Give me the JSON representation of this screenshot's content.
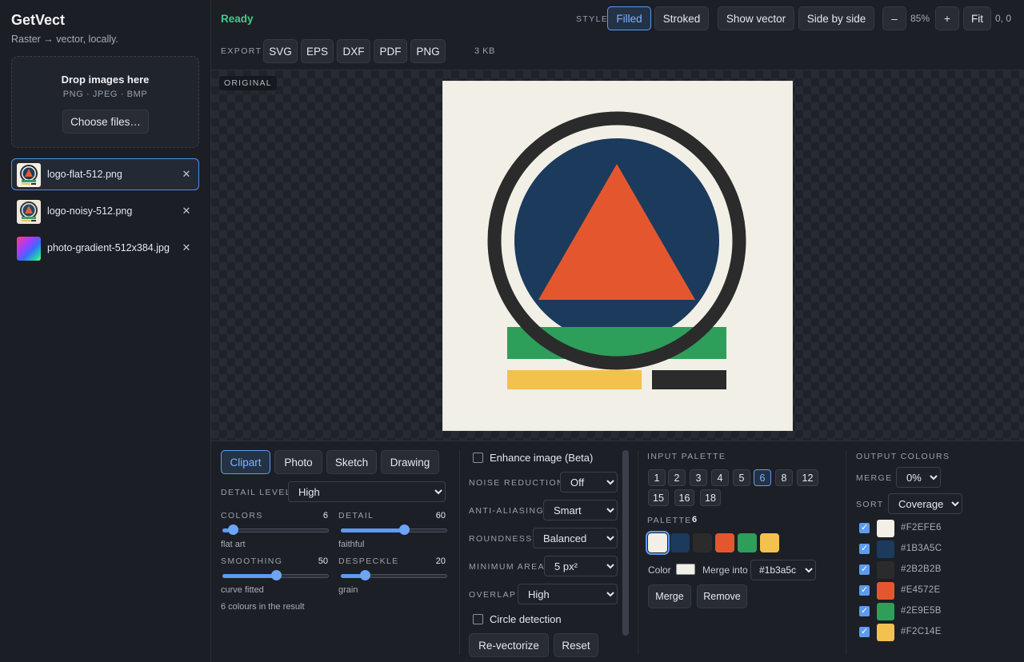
{
  "app": {
    "title": "GetVect",
    "tagline": "Raster → vector, locally."
  },
  "dropzone": {
    "title": "Drop images here",
    "formats": "PNG · JPEG · BMP",
    "choose_label": "Choose files…"
  },
  "files": [
    {
      "name": "logo-flat-512.png",
      "selected": true
    },
    {
      "name": "logo-noisy-512.png",
      "selected": false
    },
    {
      "name": "photo-gradient-512x384.jpg",
      "selected": false
    }
  ],
  "toolbar": {
    "status": "Ready",
    "style_label": "STYLE",
    "style_filled": "Filled",
    "style_stroked": "Stroked",
    "show_vector": "Show vector",
    "side_by_side": "Side by side",
    "zoom_out": "–",
    "zoom_level": "85%",
    "zoom_in": "+",
    "fit": "Fit",
    "coords": "0, 0",
    "export_label": "EXPORT",
    "export_formats": [
      "SVG",
      "EPS",
      "DXF",
      "PDF",
      "PNG"
    ],
    "file_size": "3 KB"
  },
  "canvas": {
    "tag": "ORIGINAL"
  },
  "presets": {
    "items": [
      "Clipart",
      "Photo",
      "Sketch",
      "Drawing"
    ],
    "active": "Clipart"
  },
  "controls": {
    "detail_level_label": "DETAIL LEVEL",
    "detail_level_value": "High",
    "colors_label": "COLORS",
    "colors_value": 6,
    "colors_fraction": 0.06,
    "colors_hint": "flat art",
    "detail_label": "DETAIL",
    "detail_value": 60,
    "detail_fraction": 0.6,
    "detail_hint": "faithful",
    "smoothing_label": "SMOOTHING",
    "smoothing_value": 50,
    "smoothing_fraction": 0.5,
    "smoothing_hint": "curve fitted",
    "despeckle_label": "DESPECKLE",
    "despeckle_value": 20,
    "despeckle_fraction": 0.2,
    "despeckle_hint": "grain",
    "result_note": "6 colours in the result"
  },
  "advanced": {
    "enhance_label": "Enhance image (Beta)",
    "noise_label": "NOISE REDUCTION",
    "noise_value": "Off",
    "antialias_label": "ANTI-ALIASING",
    "antialias_value": "Smart",
    "roundness_label": "ROUNDNESS",
    "roundness_value": "Balanced",
    "min_area_label": "MINIMUM AREA",
    "min_area_value": "5 px²",
    "overlap_label": "OVERLAP",
    "overlap_value": "High",
    "circle_label": "Circle detection",
    "revectorize": "Re-vectorize",
    "reset": "Reset"
  },
  "input_palette": {
    "label": "INPUT PALETTE",
    "counts": [
      "1",
      "2",
      "3",
      "4",
      "5",
      "6",
      "8",
      "12",
      "15",
      "16",
      "18"
    ],
    "active": "6",
    "palette_label": "PALETTE",
    "palette_count": "6",
    "swatches": [
      "#F2EFE6",
      "#1B3A5C",
      "#2B2B2B",
      "#E4572E",
      "#2E9E5B",
      "#F2C14E"
    ],
    "color_label": "Color",
    "color_value": "#F2EFE6",
    "merge_into_label": "Merge into",
    "merge_into_value": "#1b3a5c",
    "merge_btn": "Merge",
    "remove_btn": "Remove"
  },
  "output": {
    "label": "OUTPUT COLOURS",
    "merge_label": "MERGE",
    "merge_value": "0%",
    "sort_label": "SORT",
    "sort_value": "Coverage",
    "colours": [
      "#F2EFE6",
      "#1B3A5C",
      "#2B2B2B",
      "#E4572E",
      "#2E9E5B",
      "#F2C14E"
    ]
  }
}
